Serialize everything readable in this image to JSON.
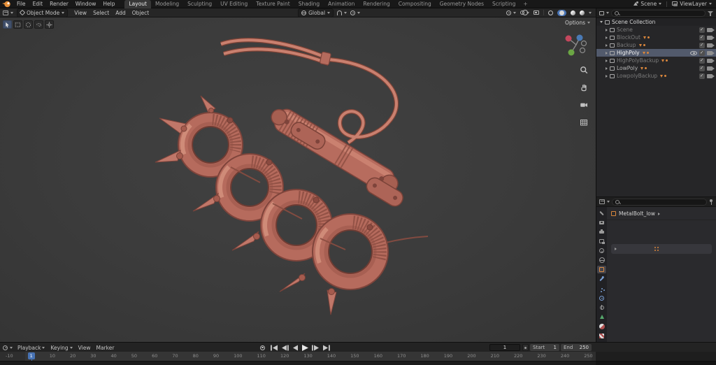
{
  "colors": {
    "accent_blue": "#4772b3",
    "object_orange": "#d9863c",
    "clay_material": "#b66b5d",
    "viewport_bg": "#3b3b3b",
    "selection_row": "#525a6c"
  },
  "icons": {
    "search": "magnifier",
    "filter": "funnel",
    "snap": "magnet",
    "render_toggle": "camera",
    "viewport_toggle": "eye",
    "exclude_toggle": "checkbox",
    "dropdown": "chevron-down"
  },
  "topbar": {
    "menus": [
      {
        "label": "File"
      },
      {
        "label": "Edit"
      },
      {
        "label": "Render"
      },
      {
        "label": "Window"
      },
      {
        "label": "Help"
      }
    ],
    "workspaces": [
      {
        "label": "Layout",
        "active": true
      },
      {
        "label": "Modeling"
      },
      {
        "label": "Sculpting"
      },
      {
        "label": "UV Editing"
      },
      {
        "label": "Texture Paint"
      },
      {
        "label": "Shading"
      },
      {
        "label": "Animation"
      },
      {
        "label": "Rendering"
      },
      {
        "label": "Compositing"
      },
      {
        "label": "Geometry Nodes"
      },
      {
        "label": "Scripting"
      }
    ],
    "add_label": "+",
    "scene": "Scene",
    "viewlayer": "ViewLayer"
  },
  "viewport": {
    "mode": "Object Mode",
    "menus": [
      {
        "label": "View"
      },
      {
        "label": "Select"
      },
      {
        "label": "Add"
      },
      {
        "label": "Object"
      }
    ],
    "orientation": "Global",
    "options": "Options"
  },
  "outliner": {
    "root": "Scene Collection",
    "rows": [
      {
        "label": "Scene",
        "dim": true,
        "check": true,
        "cam": true
      },
      {
        "label": "BlockOut",
        "dim": true,
        "objs": true,
        "check": true,
        "cam": true
      },
      {
        "label": "Backup",
        "dim": true,
        "objs": true,
        "check": true,
        "cam": true
      },
      {
        "label": "HighPoly",
        "active": true,
        "objs": true,
        "eye": true,
        "check": true,
        "cam": true
      },
      {
        "label": "HighPolyBackup",
        "dim": true,
        "objs": true,
        "check": true,
        "cam": true
      },
      {
        "label": "LowPoly",
        "objs": true,
        "check": true,
        "cam": true
      },
      {
        "label": "LowpolyBackup",
        "dim": true,
        "objs": true,
        "check": true,
        "cam": true
      }
    ]
  },
  "properties": {
    "breadcrumb": "MetalBolt_low"
  },
  "timeline": {
    "menus": [
      {
        "label": "Playback",
        "arrow": true
      },
      {
        "label": "Keying",
        "arrow": true
      },
      {
        "label": "View"
      },
      {
        "label": "Marker"
      }
    ],
    "frame": "1",
    "start_label": "Start",
    "start_value": "1",
    "end_label": "End",
    "end_value": "250",
    "ticks": [
      {
        "label": "-10"
      },
      {
        "label": "1",
        "current": true
      },
      {
        "label": "10"
      },
      {
        "label": "20"
      },
      {
        "label": "30"
      },
      {
        "label": "40"
      },
      {
        "label": "50"
      },
      {
        "label": "60"
      },
      {
        "label": "70"
      },
      {
        "label": "80"
      },
      {
        "label": "90"
      },
      {
        "label": "100"
      },
      {
        "label": "110"
      },
      {
        "label": "120"
      },
      {
        "label": "130"
      },
      {
        "label": "140"
      },
      {
        "label": "150"
      },
      {
        "label": "160"
      },
      {
        "label": "170"
      },
      {
        "label": "180"
      },
      {
        "label": "190"
      },
      {
        "label": "200"
      },
      {
        "label": "210"
      },
      {
        "label": "220"
      },
      {
        "label": "230"
      },
      {
        "label": "240"
      },
      {
        "label": "250"
      }
    ]
  }
}
